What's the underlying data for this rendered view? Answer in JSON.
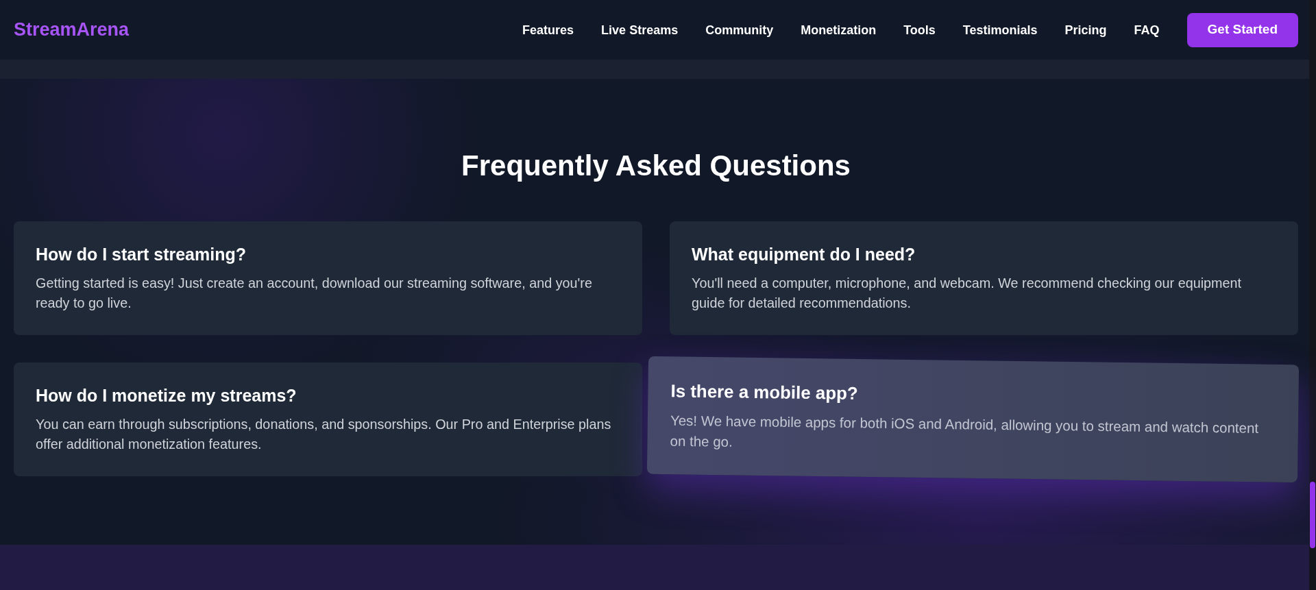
{
  "brand": {
    "name": "StreamArena"
  },
  "nav": {
    "links": [
      "Features",
      "Live Streams",
      "Community",
      "Monetization",
      "Tools",
      "Testimonials",
      "Pricing",
      "FAQ"
    ],
    "cta": "Get Started"
  },
  "faq": {
    "title": "Frequently Asked Questions",
    "items": [
      {
        "question": "How do I start streaming?",
        "answer": "Getting started is easy! Just create an account, download our streaming software, and you're ready to go live.",
        "highlighted": false
      },
      {
        "question": "What equipment do I need?",
        "answer": "You'll need a computer, microphone, and webcam. We recommend checking our equipment guide for detailed recommendations.",
        "highlighted": false
      },
      {
        "question": "How do I monetize my streams?",
        "answer": "You can earn through subscriptions, donations, and sponsorships. Our Pro and Enterprise plans offer additional monetization features.",
        "highlighted": false
      },
      {
        "question": "Is there a mobile app?",
        "answer": "Yes! We have mobile apps for both iOS and Android, allowing you to stream and watch content on the go.",
        "highlighted": true
      }
    ]
  }
}
